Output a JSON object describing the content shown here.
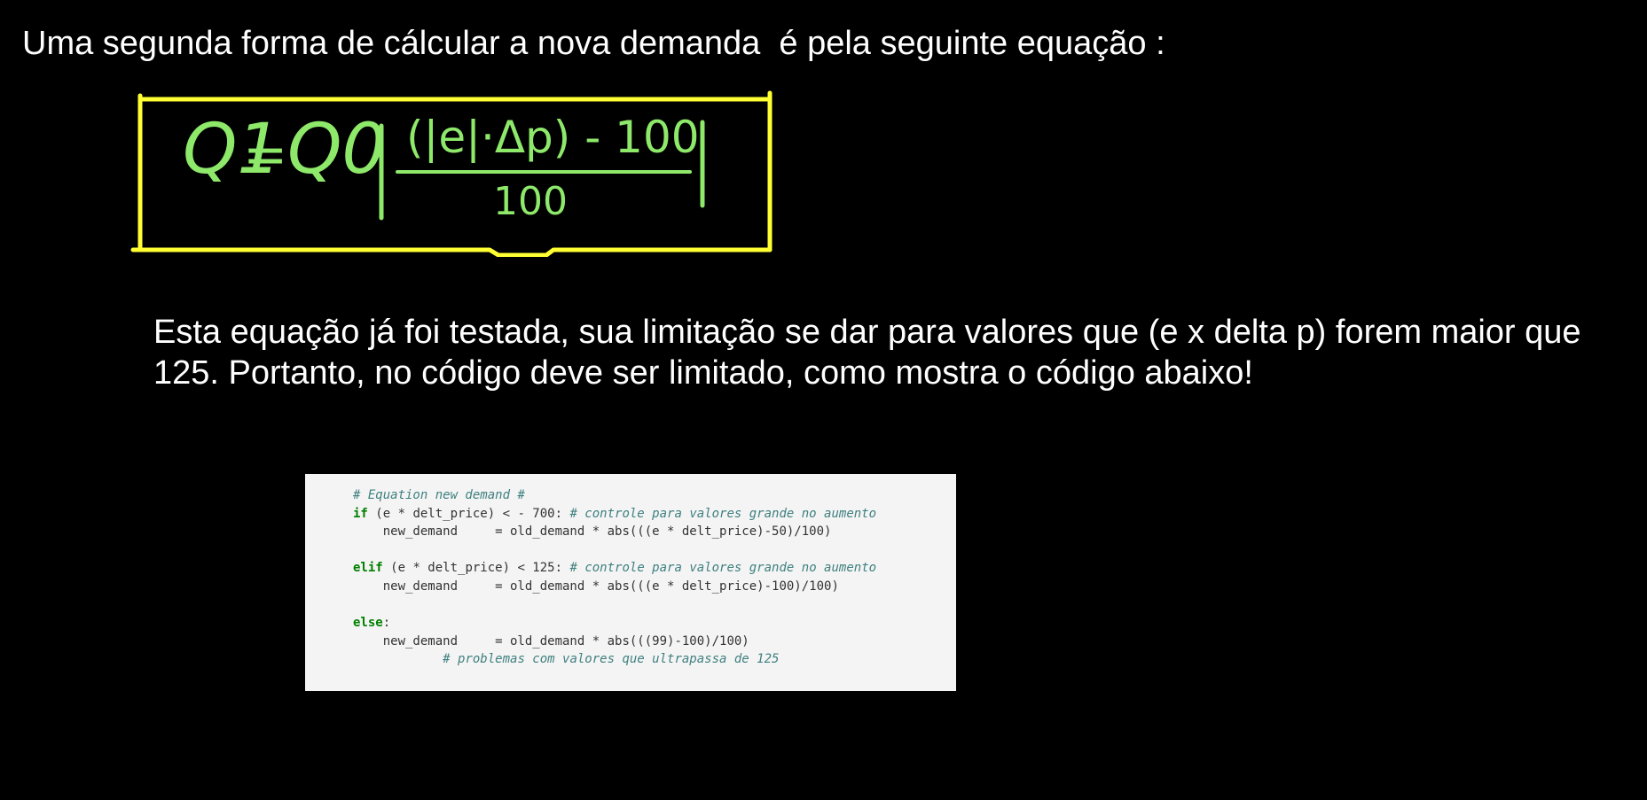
{
  "heading": "Uma segunda forma de cálcular a nova demanda  é pela seguinte equação :",
  "formula": {
    "lhs": "Q1",
    "q0": "Q0",
    "numerator": "(|e|·Δp) - 100",
    "denominator": "100"
  },
  "paragraph": "Esta equação já foi testada, sua limitação se dar para valores que (e x delta p) forem maior que 125. Portanto, no código deve ser limitado, como mostra o código abaixo!",
  "code": {
    "comment_header": "# Equation new demand #",
    "if_keyword": "if",
    "cond1": "(e * delt_price) < - 700:",
    "comment1": "# controle para valores grande no aumento",
    "assign1": "new_demand     = old_demand * abs(((e * delt_price)-50)/100)",
    "elif_keyword": "elif",
    "cond2": "(e * delt_price) < 125:",
    "comment2": "# controle para valores grande no aumento",
    "assign2": "new_demand     = old_demand * abs(((e * delt_price)-100)/100)",
    "else_keyword": "else",
    "assign3": "new_demand     = old_demand * abs(((99)-100)/100)",
    "comment3": "# problemas com valores que ultrapassa de 125"
  },
  "colors": {
    "background": "#000000",
    "text": "#ffffff",
    "formula_ink": "#8ee86a",
    "box_border": "#ffff33",
    "code_bg": "#f4f4f4"
  }
}
